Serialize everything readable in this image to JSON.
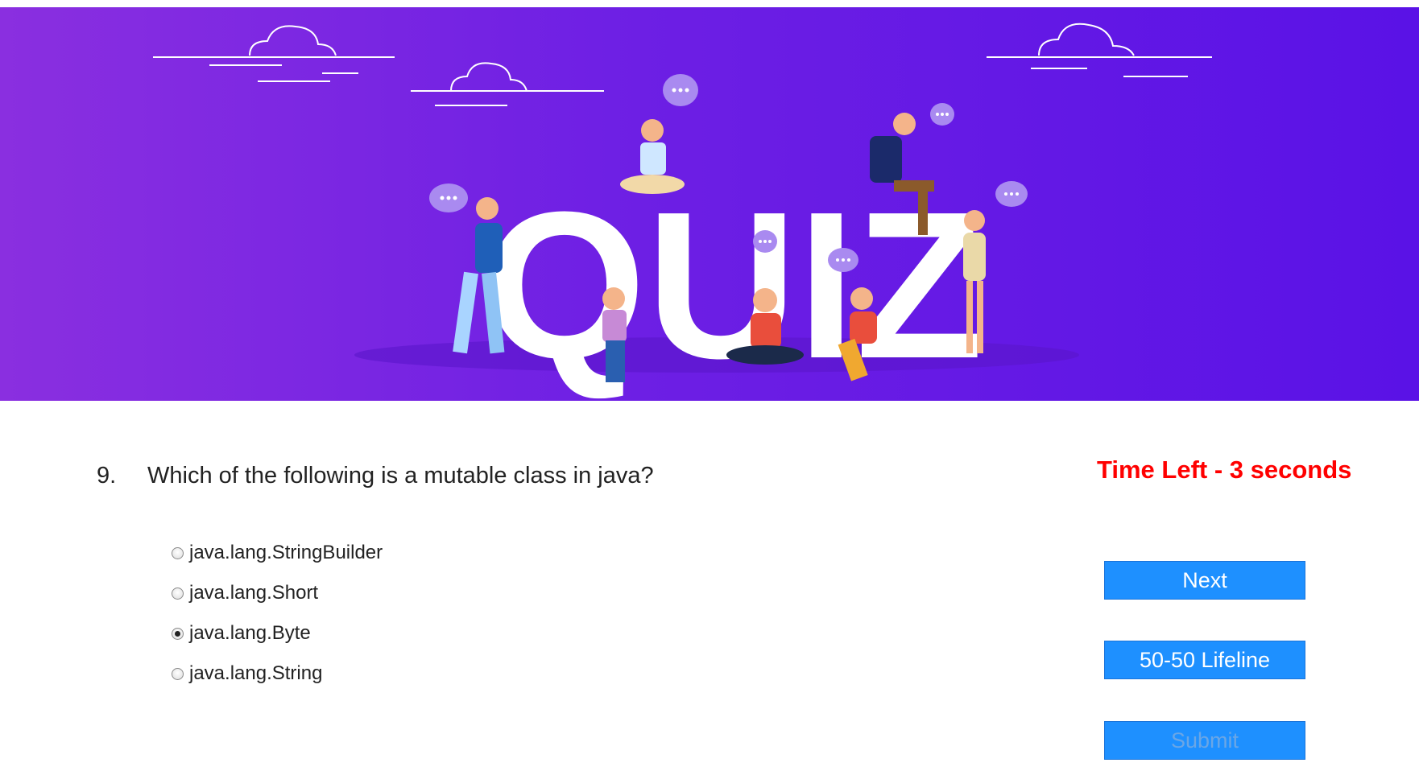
{
  "banner": {
    "title_text": "QUIZ"
  },
  "question": {
    "number": "9.",
    "text": "Which of the following is a mutable class in java?"
  },
  "timer": {
    "text": "Time Left - 3 seconds",
    "color": "#ff0000"
  },
  "options": [
    {
      "label": "java.lang.StringBuilder",
      "selected": false
    },
    {
      "label": "java.lang.Short",
      "selected": false
    },
    {
      "label": "java.lang.Byte",
      "selected": true
    },
    {
      "label": "java.lang.String",
      "selected": false
    }
  ],
  "buttons": {
    "next_label": "Next",
    "lifeline_label": "50-50 Lifeline",
    "submit_label": "Submit",
    "submit_disabled": true
  },
  "colors": {
    "accent": "#1e90ff",
    "banner": "#6d1fe4"
  }
}
